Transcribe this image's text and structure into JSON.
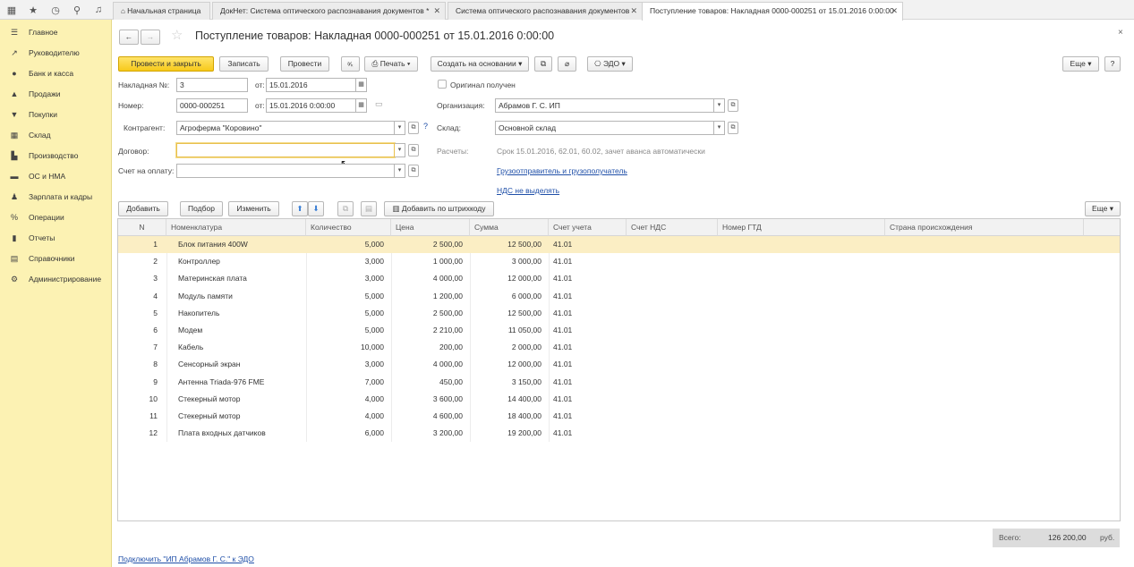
{
  "tabs": [
    {
      "label": "Начальная страница"
    },
    {
      "label": "ДокНет: Система оптического распознавания документов *"
    },
    {
      "label": "Система оптического распознавания документов"
    },
    {
      "label": "Поступление товаров: Накладная 0000-000251 от 15.01.2016 0:00:00"
    }
  ],
  "sidebar": {
    "items": [
      {
        "label": "Главное",
        "icon": "menu-icon"
      },
      {
        "label": "Руководителю",
        "icon": "trend-icon"
      },
      {
        "label": "Банк и касса",
        "icon": "coin-icon"
      },
      {
        "label": "Продажи",
        "icon": "bag-icon"
      },
      {
        "label": "Покупки",
        "icon": "cart-icon"
      },
      {
        "label": "Склад",
        "icon": "warehouse-icon"
      },
      {
        "label": "Производство",
        "icon": "factory-icon"
      },
      {
        "label": "ОС и НМА",
        "icon": "truck-icon"
      },
      {
        "label": "Зарплата и кадры",
        "icon": "person-icon"
      },
      {
        "label": "Операции",
        "icon": "operations-icon"
      },
      {
        "label": "Отчеты",
        "icon": "chart-icon"
      },
      {
        "label": "Справочники",
        "icon": "book-icon"
      },
      {
        "label": "Администрирование",
        "icon": "gear-icon"
      }
    ]
  },
  "document": {
    "title": "Поступление товаров: Накладная 0000-000251 от 15.01.2016 0:00:00",
    "close": "×"
  },
  "toolbar": {
    "post_close": "Провести и закрыть",
    "save": "Записать",
    "post": "Провести",
    "print": "Печать",
    "create_based": "Создать на основании",
    "edo": "ЭДО",
    "more": "Еще",
    "help": "?"
  },
  "form": {
    "invoice_label": "Накладная №:",
    "invoice_value": "3",
    "from_label": "от:",
    "invoice_date": "15.01.2016",
    "number_label": "Номер:",
    "number_value": "0000-000251",
    "number_date": "15.01.2016  0:00:00",
    "original_label": "Оригинал получен",
    "org_label": "Организация:",
    "org_value": "Абрамов Г. С. ИП",
    "contractor_label": "Контрагент:",
    "contractor_value": "Агроферма \"Коровино\"",
    "warehouse_label": "Склад:",
    "warehouse_value": "Основной склад",
    "contract_label": "Договор:",
    "contract_value": "",
    "settlements_label": "Расчеты:",
    "settlements_value": "Срок 15.01.2016, 62.01, 60.02, зачет аванса автоматически",
    "pay_account_label": "Счет на оплату:",
    "pay_account_value": "",
    "shipper_link": "Грузоотправитель и грузополучатель",
    "vat_link": "НДС не выделять"
  },
  "table_toolbar": {
    "add": "Добавить",
    "pick": "Подбор",
    "change": "Изменить",
    "add_barcode": "Добавить по штрихкоду",
    "more": "Еще"
  },
  "table": {
    "headers": [
      "N",
      "Номенклатура",
      "Количество",
      "Цена",
      "Сумма",
      "Счет учета",
      "Счет НДС",
      "Номер ГТД",
      "Страна происхождения"
    ],
    "rows": [
      [
        "1",
        "Блок питания 400W",
        "5,000",
        "2 500,00",
        "12 500,00",
        "41.01"
      ],
      [
        "2",
        "Контроллер",
        "3,000",
        "1 000,00",
        "3 000,00",
        "41.01"
      ],
      [
        "3",
        "Материнская плата",
        "3,000",
        "4 000,00",
        "12 000,00",
        "41.01"
      ],
      [
        "4",
        "Модуль памяти",
        "5,000",
        "1 200,00",
        "6 000,00",
        "41.01"
      ],
      [
        "5",
        "Накопитель",
        "5,000",
        "2 500,00",
        "12 500,00",
        "41.01"
      ],
      [
        "6",
        "Модем",
        "5,000",
        "2 210,00",
        "11 050,00",
        "41.01"
      ],
      [
        "7",
        "Кабель",
        "10,000",
        "200,00",
        "2 000,00",
        "41.01"
      ],
      [
        "8",
        "Сенсорный экран",
        "3,000",
        "4 000,00",
        "12 000,00",
        "41.01"
      ],
      [
        "9",
        "Антенна Triada-976 FME",
        "7,000",
        "450,00",
        "3 150,00",
        "41.01"
      ],
      [
        "10",
        "Стекерный мотор",
        "4,000",
        "3 600,00",
        "14 400,00",
        "41.01"
      ],
      [
        "11",
        "Стекерный мотор",
        "4,000",
        "4 600,00",
        "18 400,00",
        "41.01"
      ],
      [
        "12",
        "Плата входных датчиков",
        "6,000",
        "3 200,00",
        "19 200,00",
        "41.01"
      ]
    ]
  },
  "footer": {
    "total_label": "Всего:",
    "total_value": "126 200,00",
    "currency": "руб.",
    "edo_link": "Подключить \"ИП Абрамов Г. С.\" к ЭДО"
  }
}
